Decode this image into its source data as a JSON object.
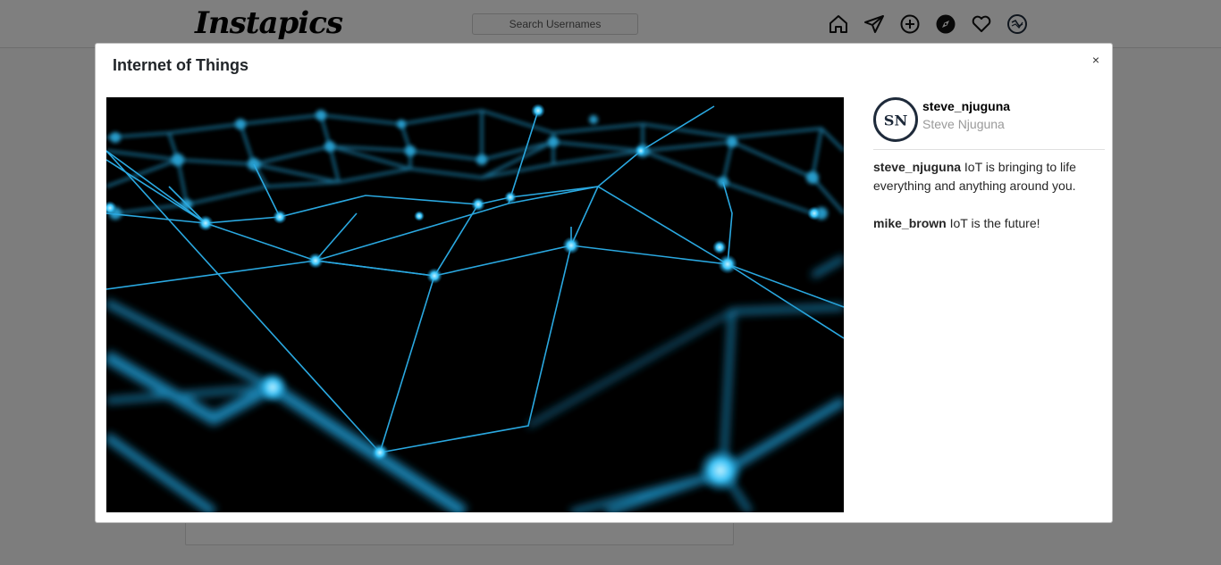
{
  "navbar": {
    "logo": "Instapics",
    "search_placeholder": "Search Usernames",
    "icons": [
      "home-icon",
      "direct-send-icon",
      "add-post-icon",
      "explore-compass-icon",
      "heart-icon",
      "profile-avatar-icon"
    ]
  },
  "modal": {
    "title": "Internet of Things",
    "close_label": "×",
    "post": {
      "author": {
        "username": "steve_njuguna",
        "full_name": "Steve Njuguna",
        "avatar_initials": "SN"
      },
      "comments": [
        {
          "user": "steve_njuguna",
          "text": "IoT is bringing to life everything and anything around you."
        },
        {
          "user": "mike_brown",
          "text": "IoT is the future!"
        }
      ]
    }
  },
  "colors": {
    "accent": "#2fb8f5",
    "image_background": "#000000",
    "overlay": "rgba(0,0,0,0.5)"
  }
}
